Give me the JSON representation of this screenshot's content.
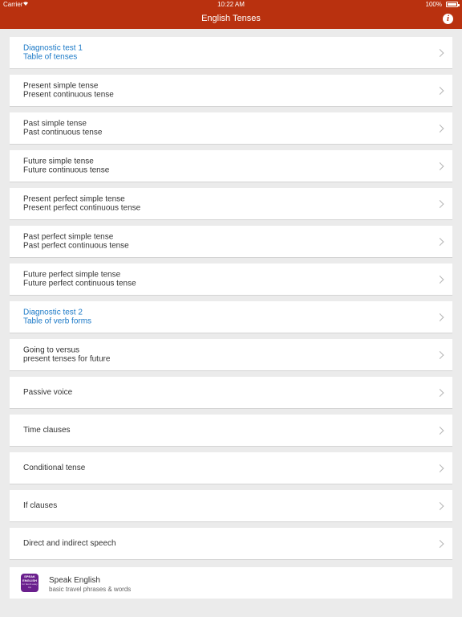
{
  "status_bar": {
    "carrier": "Carrier",
    "time": "10:22 AM",
    "battery": "100%"
  },
  "nav": {
    "title": "English Tenses",
    "info_icon": "i"
  },
  "menu": [
    {
      "line1": "Diagnostic test 1",
      "line2": "Table of tenses",
      "style": "link"
    },
    {
      "line1": "Present simple tense",
      "line2": "Present continuous tense",
      "style": "normal"
    },
    {
      "line1": "Past simple tense",
      "line2": "Past continuous tense",
      "style": "normal"
    },
    {
      "line1": "Future simple tense",
      "line2": "Future continuous tense",
      "style": "normal"
    },
    {
      "line1": "Present perfect simple tense",
      "line2": "Present perfect continuous tense",
      "style": "normal"
    },
    {
      "line1": "Past perfect simple tense",
      "line2": "Past perfect continuous tense",
      "style": "normal"
    },
    {
      "line1": "Future perfect simple tense",
      "line2": "Future perfect continuous tense",
      "style": "normal"
    },
    {
      "line1": "Diagnostic test 2",
      "line2": "Table of verb forms",
      "style": "link"
    },
    {
      "line1": "Going to versus",
      "line2": "present tenses for future",
      "style": "normal"
    },
    {
      "line1": "Passive voice",
      "style": "normal"
    },
    {
      "line1": "Time clauses",
      "style": "normal"
    },
    {
      "line1": "Conditional tense",
      "style": "normal"
    },
    {
      "line1": "If clauses",
      "style": "normal"
    },
    {
      "line1": "Direct and indirect speech",
      "style": "normal"
    }
  ],
  "promo": {
    "icon_text": "SPEAK ENGLISH",
    "icon_subtext": "for fast & easy trip",
    "title": "Speak English",
    "subtitle": "basic travel phrases & words"
  },
  "colors": {
    "header": "#b9310f",
    "link": "#1b79c7",
    "background": "#ebebeb"
  }
}
